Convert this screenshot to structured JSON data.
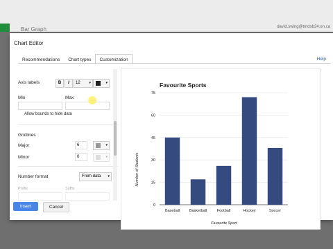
{
  "background": {
    "doc_title": "Bar Graph",
    "user_email": "david.swing@tmdsb24.on.ca"
  },
  "dialog": {
    "title": "Chart Editor",
    "tabs": [
      "Recommendations",
      "Chart types",
      "Customization"
    ],
    "active_tab": "Customization",
    "help": "Help"
  },
  "panel": {
    "axis_labels": "Axis labels",
    "bold": "B",
    "italic": "I",
    "font_size": "12",
    "min": "Min",
    "max": "Max",
    "allow_bounds": "Allow bounds to hide data",
    "gridlines": "Gridlines",
    "major": "Major",
    "major_value": "6",
    "minor": "Minor",
    "minor_value": "0",
    "number_format": "Number format",
    "number_format_value": "From data",
    "prefix": "Prefix",
    "suffix": "Suffix"
  },
  "buttons": {
    "insert": "Insert",
    "cancel": "Cancel"
  },
  "colors": {
    "bar": "#354a7e",
    "accent": "#4a86e8"
  },
  "chart_data": {
    "type": "bar",
    "title": "Favourite Sports",
    "xlabel": "Favourite Sport",
    "ylabel": "Number of Students",
    "categories": [
      "Baseball",
      "Basketball",
      "Football",
      "Hockey",
      "Soccer"
    ],
    "values": [
      45,
      17,
      26,
      72,
      38
    ],
    "ylim": [
      0,
      75
    ],
    "yticks": [
      "0",
      "15",
      "30",
      "45",
      "60",
      "75"
    ],
    "grid": true
  }
}
